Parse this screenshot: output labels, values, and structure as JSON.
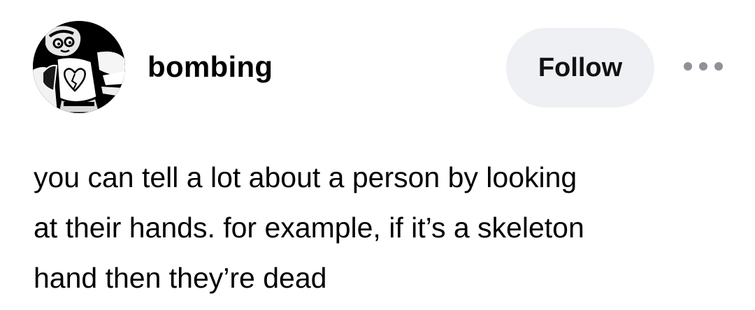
{
  "post": {
    "author": {
      "username": "bombing",
      "avatar_description": "black and white cartoon avatar"
    },
    "follow_label": "Follow",
    "more_icon": "more-horizontal-icon",
    "body_lines": [
      "you can tell a lot about a person by looking",
      "at their hands. for example, if it’s a skeleton",
      "hand then they’re dead"
    ]
  },
  "colors": {
    "background": "#ffffff",
    "text": "#000000",
    "follow_button_bg": "#eef0f3",
    "more_dots": "#8e9196"
  }
}
